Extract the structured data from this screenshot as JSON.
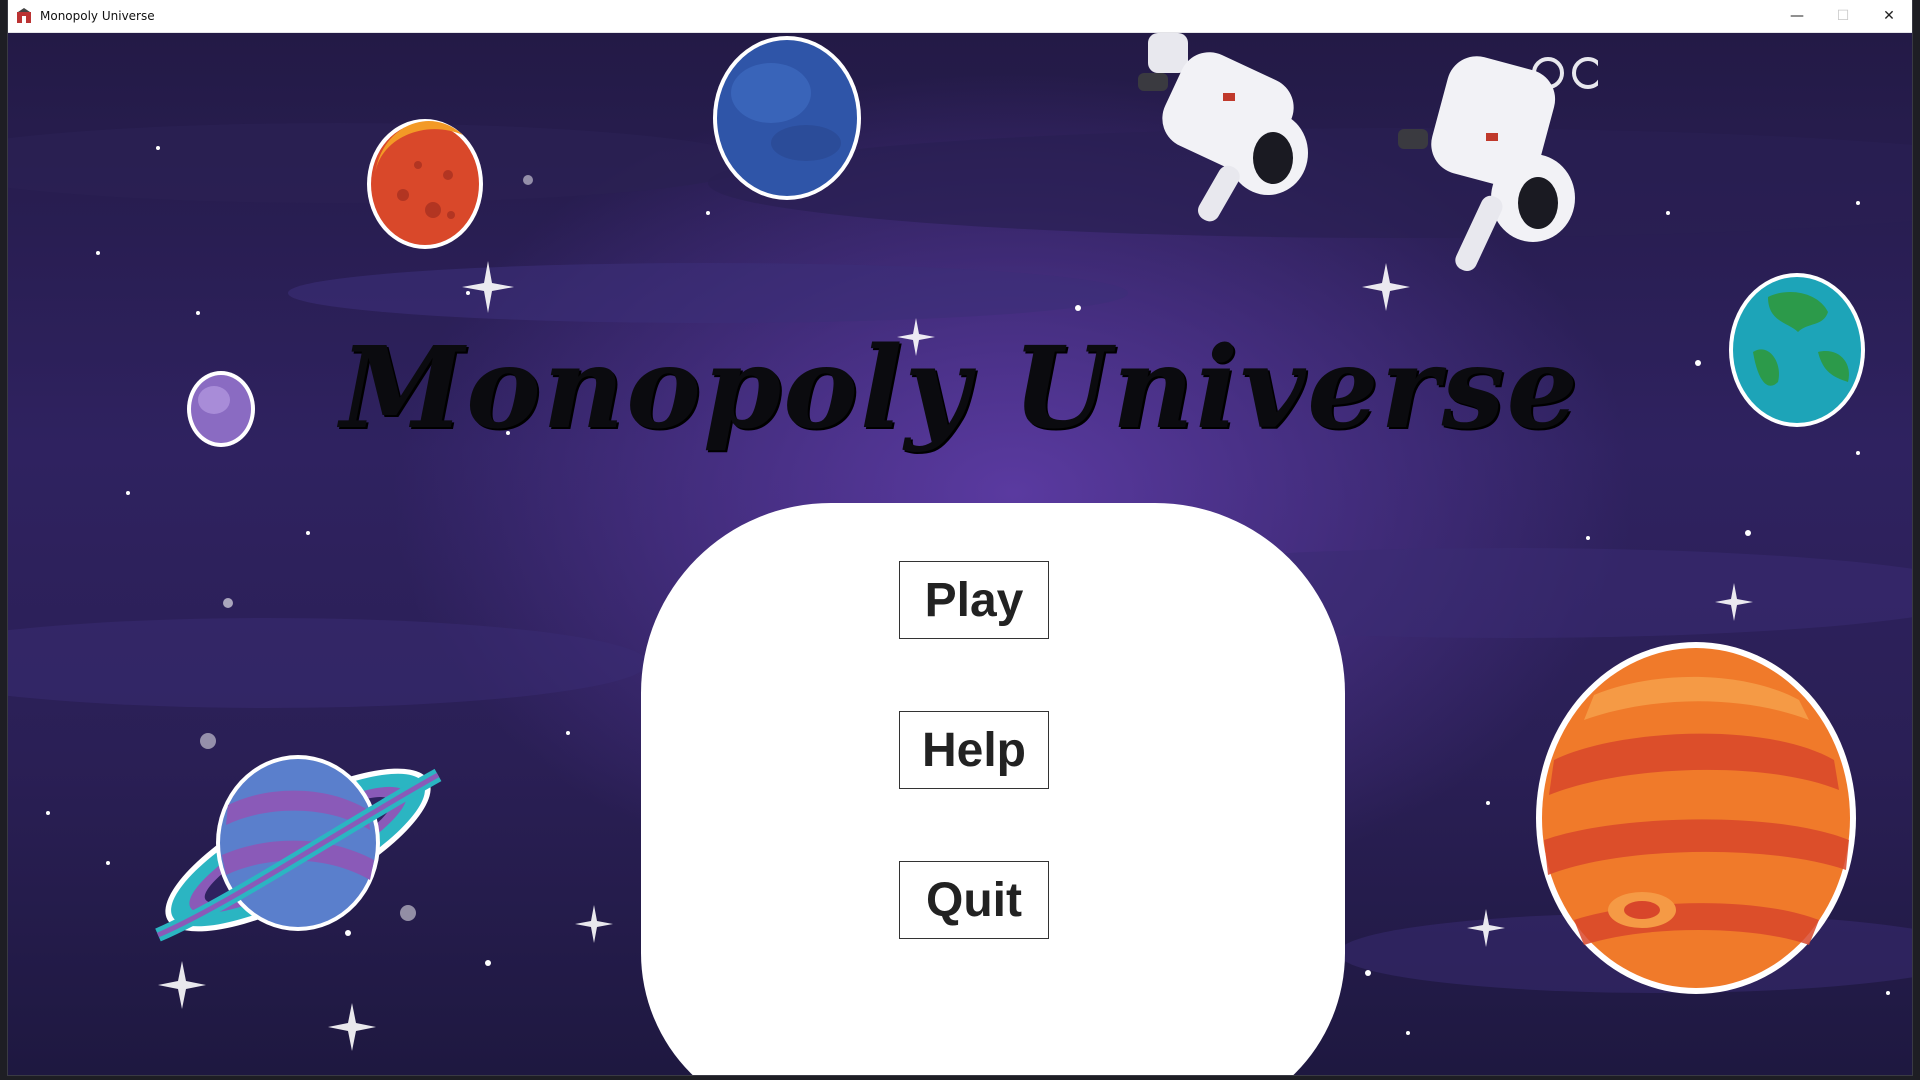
{
  "window": {
    "title": "Monopoly Universe",
    "minimize_glyph": "—",
    "maximize_glyph": "☐",
    "close_glyph": "✕"
  },
  "game": {
    "title": "Monopoly Universe"
  },
  "menu": {
    "play_label": "Play",
    "help_label": "Help",
    "quit_label": "Quit"
  },
  "colors": {
    "background_top": "#231a46",
    "background_glow": "#5a3aa0",
    "panel": "#ffffff",
    "title_text": "#0b0b0f"
  },
  "icons": {
    "app": "monopoly-app-icon",
    "planets": [
      "orange-planet",
      "blue-planet",
      "small-purple-planet",
      "earth-planet",
      "ringed-planet",
      "jupiter-planet"
    ],
    "astronauts": [
      "astronaut",
      "astronaut"
    ]
  }
}
